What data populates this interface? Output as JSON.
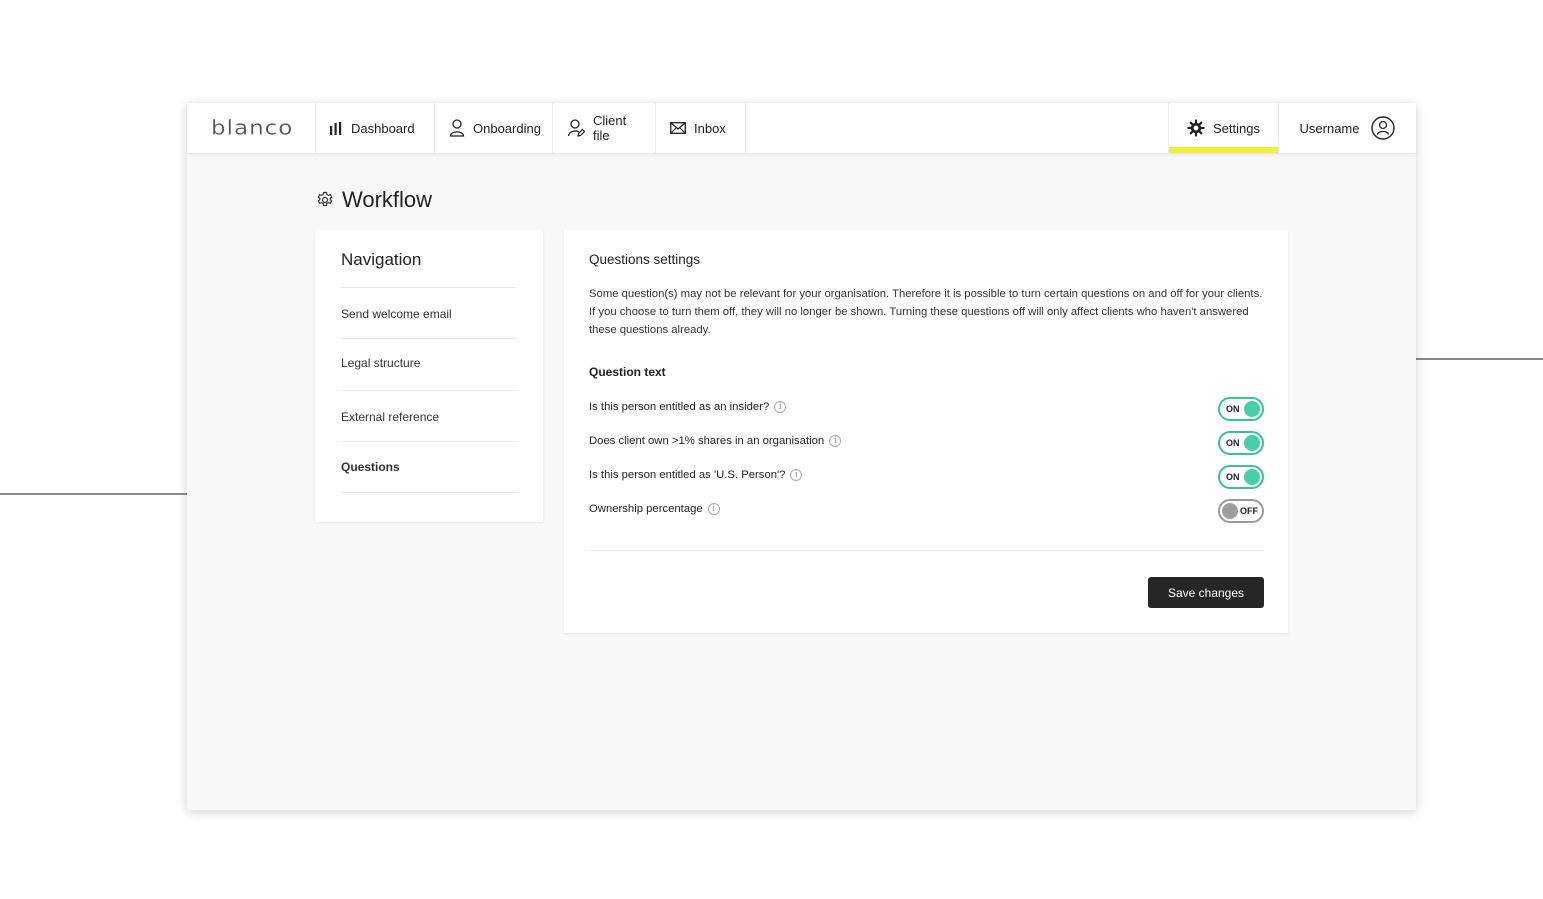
{
  "brand": {
    "logo": "blanco"
  },
  "topnav": {
    "items": [
      {
        "label": "Dashboard",
        "icon": "bar-chart-icon"
      },
      {
        "label": "Onboarding",
        "icon": "person-icon"
      },
      {
        "label": "Client file",
        "icon": "person-edit-icon"
      },
      {
        "label": "Inbox",
        "icon": "envelope-icon"
      }
    ],
    "settings": {
      "label": "Settings",
      "icon": "gear-icon",
      "active": true
    },
    "user": {
      "label": "Username",
      "icon": "user-circle-icon"
    }
  },
  "page": {
    "title": "Workflow",
    "icon": "gear-icon"
  },
  "sidebar": {
    "heading": "Navigation",
    "items": [
      {
        "label": "Send welcome email",
        "active": false
      },
      {
        "label": "Legal structure",
        "active": false
      },
      {
        "label": "External reference",
        "active": false
      },
      {
        "label": "Questions",
        "active": true
      }
    ]
  },
  "content": {
    "heading": "Questions settings",
    "description": "Some question(s) may not be relevant for your organisation. Therefore it is possible to turn certain questions on and off for your clients. If you choose to turn them off, they will no longer be shown. Turning these questions off will only affect clients who haven't answered these questions already.",
    "column_header": "Question text",
    "questions": [
      {
        "text": "Is this person entitled as an insider?",
        "state": "ON"
      },
      {
        "text": "Does client own >1% shares in an organisation",
        "state": "ON"
      },
      {
        "text": "Is this person entitled as 'U.S. Person'?",
        "state": "ON"
      },
      {
        "text": "Ownership percentage",
        "state": "OFF"
      }
    ],
    "info_glyph": "i",
    "save_label": "Save changes"
  },
  "colors": {
    "accent_underline": "#f1ef3a",
    "toggle_on": "#44d0a6",
    "toggle_off": "#9e9e9e",
    "button_bg": "#262626"
  }
}
